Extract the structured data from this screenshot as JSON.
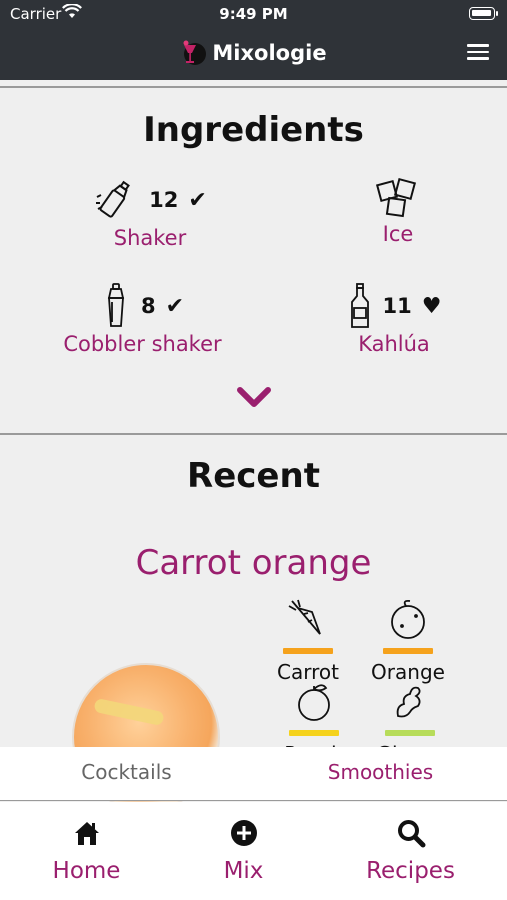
{
  "status_bar": {
    "carrier": "Carrier",
    "time": "9:49 PM"
  },
  "nav": {
    "title": "Mixologie"
  },
  "ingredients": {
    "title": "Ingredients",
    "items": [
      {
        "label": "Shaker",
        "count": "12",
        "status_icon": "check-icon"
      },
      {
        "label": "Ice",
        "count": "",
        "status_icon": ""
      },
      {
        "label": "Cobbler shaker",
        "count": "8",
        "status_icon": "check-icon"
      },
      {
        "label": "Kahlúa",
        "count": "11",
        "status_icon": "heart-icon"
      }
    ]
  },
  "recent": {
    "title": "Recent",
    "drink_name": "Carrot orange",
    "fruits": [
      {
        "name": "Carrot",
        "bar_color": "#f5a21c"
      },
      {
        "name": "Orange",
        "bar_color": "#f5a21c"
      },
      {
        "name": "Peach",
        "bar_color": "#f5d21c"
      },
      {
        "name": "Ginger",
        "bar_color": "#b7dc5a"
      }
    ]
  },
  "segment_tabs": {
    "cocktails": "Cocktails",
    "smoothies": "Smoothies"
  },
  "tab_bar": {
    "home": "Home",
    "mix": "Mix",
    "recipes": "Recipes"
  },
  "colors": {
    "accent": "#9a1f6e",
    "header_bg": "#2f3338",
    "page_bg": "#efefef"
  }
}
